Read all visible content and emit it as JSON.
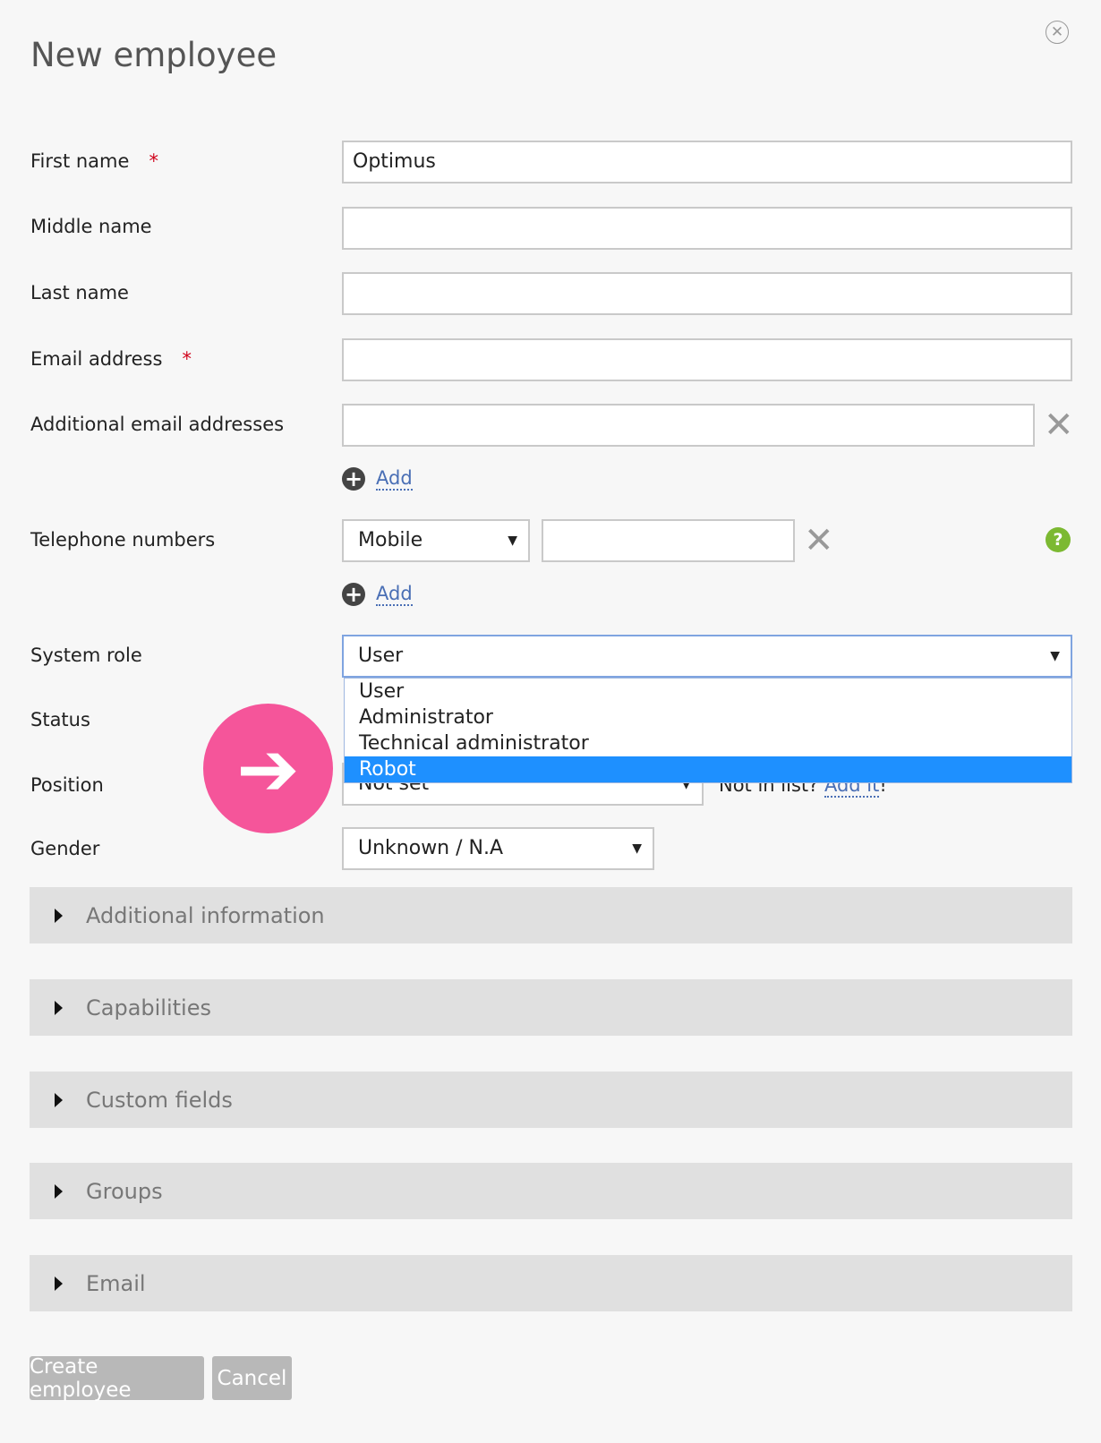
{
  "title": "New employee",
  "fields": {
    "first_name": {
      "label": "First name",
      "required": "*",
      "value": "Optimus"
    },
    "middle_name": {
      "label": "Middle name",
      "value": ""
    },
    "last_name": {
      "label": "Last name",
      "value": ""
    },
    "email": {
      "label": "Email address",
      "required": "*",
      "value": ""
    },
    "additional_email": {
      "label": "Additional email addresses",
      "value": "",
      "add_label": "Add"
    },
    "telephone": {
      "label": "Telephone numbers",
      "type_value": "Mobile",
      "number_value": "",
      "add_label": "Add"
    },
    "system_role": {
      "label": "System role",
      "value": "User",
      "options": [
        "User",
        "Administrator",
        "Technical administrator",
        "Robot"
      ]
    },
    "status": {
      "label": "Status"
    },
    "position": {
      "label": "Position",
      "value": "Not set",
      "not_in_list": "Not in list?",
      "add_it": "Add it",
      "bang": "!"
    },
    "gender": {
      "label": "Gender",
      "value": "Unknown / N.A"
    }
  },
  "sections": [
    "Additional information",
    "Capabilities",
    "Custom fields",
    "Groups",
    "Email"
  ],
  "buttons": {
    "create": "Create employee",
    "cancel": "Cancel"
  },
  "icons": {
    "close": "close-circle-icon",
    "remove": "x-icon",
    "add": "plus-circle-icon",
    "help": "question-icon",
    "arrow": "arrow-right-icon"
  },
  "colors": {
    "required": "#d0021b",
    "link": "#4a6fb5",
    "help": "#7cb932",
    "highlight": "#1e90ff",
    "pointer": "#f5559a"
  }
}
